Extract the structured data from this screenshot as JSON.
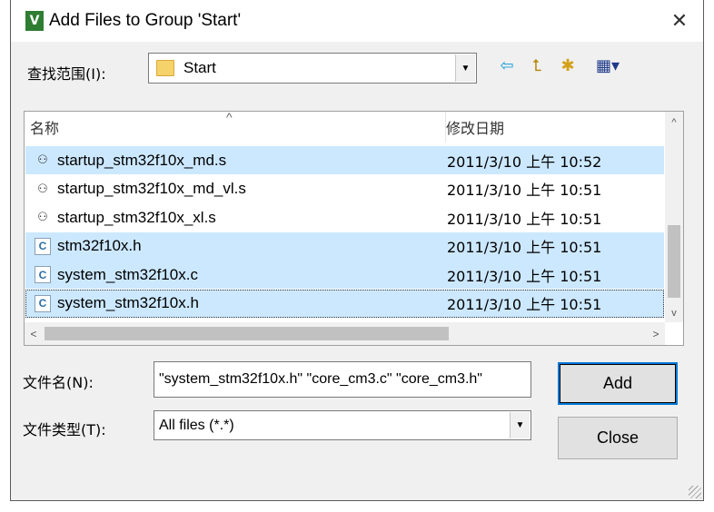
{
  "window": {
    "title": "Add Files to Group 'Start'",
    "app_icon": "µ-vision-icon",
    "close_glyph": "✕"
  },
  "lookin": {
    "label": "查找范围(I):",
    "value": "Start",
    "dropdown_glyph": "▼"
  },
  "toolbar": {
    "back_glyph": "⇦",
    "up_glyph": "⮤",
    "newfolder_glyph": "✱",
    "view_glyph": "▦▾"
  },
  "list": {
    "columns": {
      "name": "名称",
      "date": "修改日期"
    },
    "sort_glyph": "^",
    "rows": [
      {
        "name": "startup_stm32f10x_md.s",
        "date": "2011/3/10 上午 10:52",
        "kind": "asm",
        "icon_glyph": "⚇",
        "selected": true,
        "focused": false
      },
      {
        "name": "startup_stm32f10x_md_vl.s",
        "date": "2011/3/10 上午 10:51",
        "kind": "asm",
        "icon_glyph": "⚇",
        "selected": false,
        "focused": false
      },
      {
        "name": "startup_stm32f10x_xl.s",
        "date": "2011/3/10 上午 10:51",
        "kind": "asm",
        "icon_glyph": "⚇",
        "selected": false,
        "focused": false
      },
      {
        "name": "stm32f10x.h",
        "date": "2011/3/10 上午 10:51",
        "kind": "src",
        "icon_glyph": "C",
        "selected": true,
        "focused": false
      },
      {
        "name": "system_stm32f10x.c",
        "date": "2011/3/10 上午 10:51",
        "kind": "src",
        "icon_glyph": "C",
        "selected": true,
        "focused": false
      },
      {
        "name": "system_stm32f10x.h",
        "date": "2011/3/10 上午 10:51",
        "kind": "src",
        "icon_glyph": "C",
        "selected": true,
        "focused": true
      }
    ],
    "scroll_up": "^",
    "scroll_down": "v",
    "scroll_left": "<",
    "scroll_right": ">"
  },
  "filename": {
    "label": "文件名(N):",
    "value": "\"system_stm32f10x.h\" \"core_cm3.c\" \"core_cm3.h\""
  },
  "filetype": {
    "label": "文件类型(T):",
    "value": "All files (*.*)",
    "dropdown_glyph": "▼"
  },
  "buttons": {
    "add": "Add",
    "close": "Close"
  },
  "colors": {
    "selection": "#cce8ff",
    "accent": "#0078d7"
  }
}
